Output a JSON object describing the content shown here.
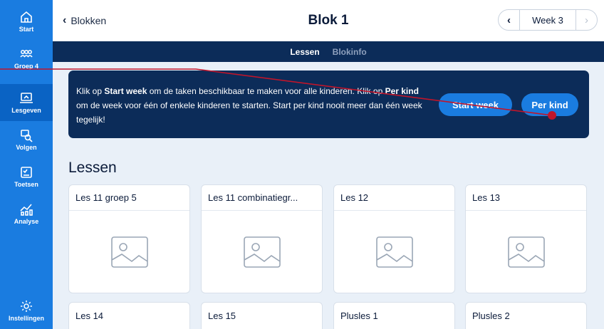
{
  "sidebar": {
    "items": [
      {
        "label": "Start",
        "icon": "home-icon"
      },
      {
        "label": "Groep 4",
        "icon": "group-icon"
      },
      {
        "label": "Lesgeven",
        "icon": "lesson-icon"
      },
      {
        "label": "Volgen",
        "icon": "follow-icon"
      },
      {
        "label": "Toetsen",
        "icon": "test-icon"
      },
      {
        "label": "Analyse",
        "icon": "analyse-icon"
      },
      {
        "label": "Instellingen",
        "icon": "gear-icon"
      }
    ],
    "active": "Lesgeven"
  },
  "header": {
    "back_label": "Blokken",
    "title": "Blok 1",
    "week_label": "Week 3"
  },
  "tabs": [
    {
      "label": "Lessen",
      "active": true
    },
    {
      "label": "Blokinfo",
      "active": false
    }
  ],
  "banner": {
    "text_1": "Klik op ",
    "bold_1": "Start week",
    "text_2": " om de taken beschikbaar te maken voor alle kinderen. Klik op ",
    "bold_2": "Per kind",
    "text_3": " om de week voor één of enkele kinderen te starten. Start per kind nooit meer dan één week tegelijk!",
    "start_button": "Start week",
    "per_kind_button": "Per kind"
  },
  "section_title": "Lessen",
  "cards": [
    {
      "title": "Les 11 groep 5"
    },
    {
      "title": "Les 11 combinatiegr..."
    },
    {
      "title": "Les 12"
    },
    {
      "title": "Les 13"
    },
    {
      "title": "Les 14"
    },
    {
      "title": "Les 15"
    },
    {
      "title": "Plusles 1"
    },
    {
      "title": "Plusles 2"
    }
  ],
  "colors": {
    "sidebar": "#1a7ce0",
    "sidebar_active": "#0a63c4",
    "navy": "#0c2c59",
    "background": "#e9f0f8",
    "annotation_line": "#c0152a"
  }
}
